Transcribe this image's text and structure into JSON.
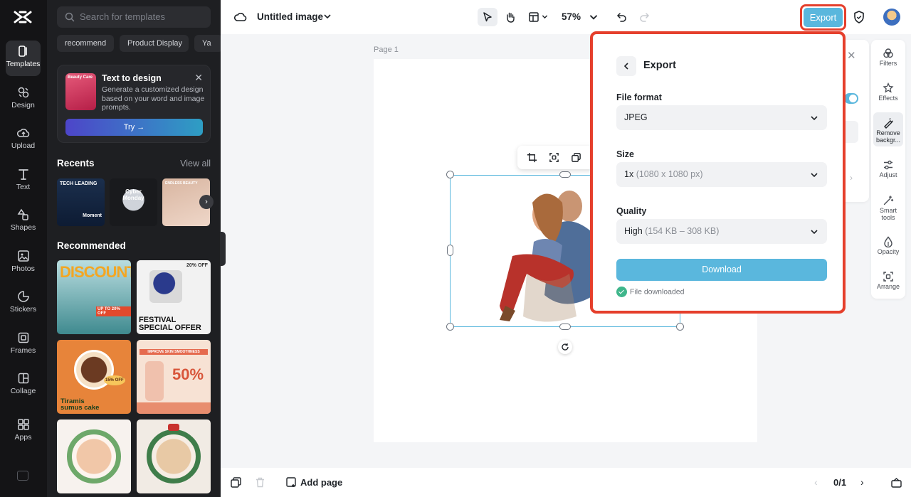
{
  "rail": {
    "items": [
      {
        "label": "Templates",
        "icon": "templates-icon",
        "active": true
      },
      {
        "label": "Design",
        "icon": "design-icon"
      },
      {
        "label": "Upload",
        "icon": "upload-icon"
      },
      {
        "label": "Text",
        "icon": "text-icon"
      },
      {
        "label": "Shapes",
        "icon": "shapes-icon"
      },
      {
        "label": "Photos",
        "icon": "photos-icon"
      },
      {
        "label": "Stickers",
        "icon": "stickers-icon"
      },
      {
        "label": "Frames",
        "icon": "frames-icon"
      },
      {
        "label": "Collage",
        "icon": "collage-icon"
      },
      {
        "label": "Apps",
        "icon": "apps-icon"
      }
    ]
  },
  "panel": {
    "search_placeholder": "Search for templates",
    "chips": [
      "recommend",
      "Product Display",
      "Ya"
    ],
    "promo": {
      "thumb_text": "Beauty Care",
      "title": "Text to design",
      "description": "Generate a customized design based on your word and image prompts.",
      "button": "Try →"
    },
    "recents_title": "Recents",
    "view_all": "View all",
    "recents": [
      {
        "line1": "TECH LEADING",
        "line2": "Moment"
      },
      {
        "line1": "Cyber",
        "line2": "Monday"
      },
      {
        "line1": "ENDLESS BEAUTY",
        "line2": ""
      }
    ],
    "recommended_title": "Recommended",
    "templates": [
      {
        "big": "DISCOUNT",
        "small": "UP TO 20% OFF"
      },
      {
        "big": "FESTIVAL SPECIAL OFFER",
        "small": "20% OFF"
      },
      {
        "big": "Tiramis sumus cake",
        "small": "15% OFF"
      },
      {
        "big": "50%",
        "small": "IMPROVE SKIN SMOOTHNESS"
      },
      {
        "big": "",
        "small": ""
      },
      {
        "big": "",
        "small": ""
      }
    ]
  },
  "topbar": {
    "doc_title": "Untitled image",
    "zoom": "57%",
    "export_label": "Export"
  },
  "canvas": {
    "page_label": "Page 1"
  },
  "toolstrip": {
    "items": [
      {
        "label": "Filters"
      },
      {
        "label": "Effects"
      },
      {
        "label": "Remove backgr...",
        "active": true
      },
      {
        "label": "Adjust"
      },
      {
        "label": "Smart tools"
      },
      {
        "label": "Opacity"
      },
      {
        "label": "Arrange"
      }
    ]
  },
  "bottombar": {
    "add_page": "Add page",
    "pager": "0/1"
  },
  "export_panel": {
    "title": "Export",
    "file_format_label": "File format",
    "file_format_value": "JPEG",
    "size_label": "Size",
    "size_value": "1x",
    "size_detail": "(1080 x 1080 px)",
    "quality_label": "Quality",
    "quality_value": "High",
    "quality_detail": "(154 KB – 308 KB)",
    "download_label": "Download",
    "status_text": "File downloaded"
  },
  "colors": {
    "accent": "#5ab7dd",
    "highlight": "#e53f2c",
    "success": "#3fb68b",
    "rail_bg": "#141416",
    "panel_bg": "#1e1f22"
  }
}
